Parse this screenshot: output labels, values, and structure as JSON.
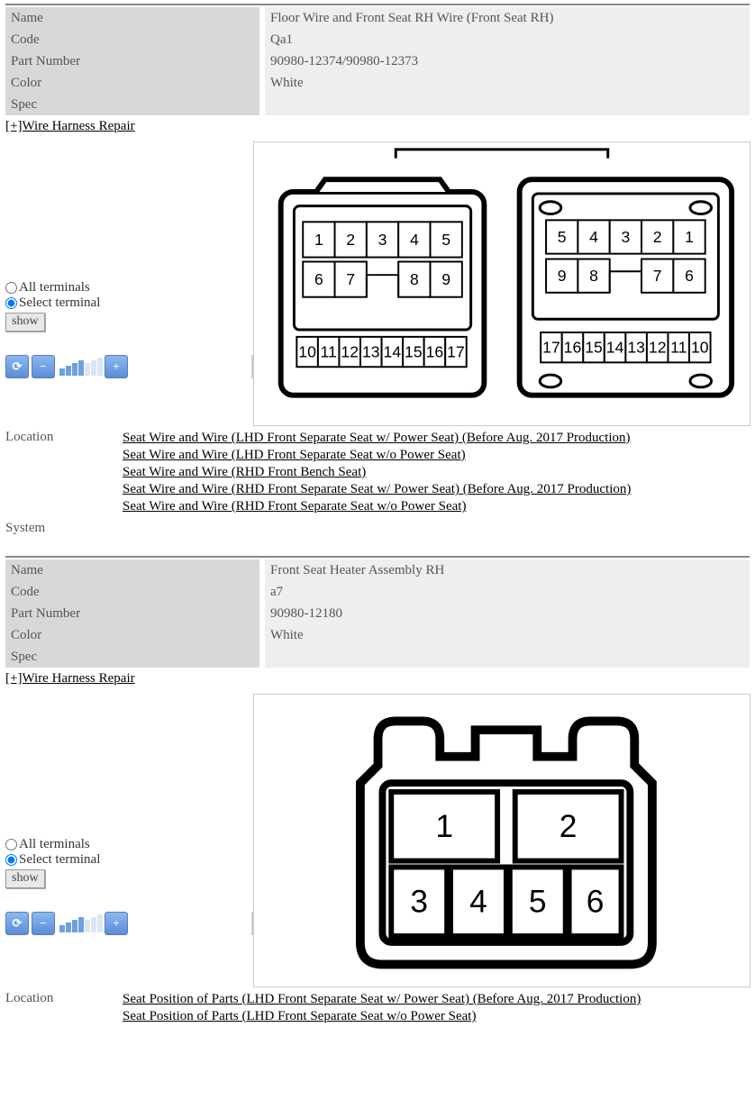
{
  "sections": [
    {
      "info": {
        "name_label": "Name",
        "name": "Floor Wire and Front Seat RH Wire (Front Seat RH)",
        "code_label": "Code",
        "code": "Qa1",
        "pn_label": "Part Number",
        "pn": "90980-12374/90980-12373",
        "color_label": "Color",
        "color": "White",
        "spec_label": "Spec",
        "spec": ""
      },
      "harness_link": "[+]Wire Harness Repair",
      "controls": {
        "all": "All terminals",
        "select": "Select terminal",
        "show": "show"
      },
      "connector_left_pins": {
        "row1": [
          1,
          2,
          3,
          4,
          5
        ],
        "row2": [
          6,
          7,
          8,
          9
        ],
        "row3": [
          10,
          11,
          12,
          13,
          14,
          15,
          16,
          17
        ]
      },
      "connector_right_pins": {
        "row1": [
          5,
          4,
          3,
          2,
          1
        ],
        "row2": [
          9,
          8,
          7,
          6
        ],
        "row3": [
          17,
          16,
          15,
          14,
          13,
          12,
          11,
          10
        ]
      },
      "location_label": "Location",
      "locations": [
        "Seat  Wire and Wire (LHD Front Separate Seat w/ Power Seat) (Before Aug. 2017 Production)",
        "Seat  Wire and Wire (LHD Front Separate Seat w/o Power Seat)",
        "Seat  Wire and Wire (RHD Front Bench Seat)",
        "Seat  Wire and Wire (RHD Front Separate Seat w/ Power Seat) (Before Aug. 2017 Production)",
        "Seat  Wire and Wire (RHD Front Separate Seat w/o Power Seat)"
      ],
      "system_label": "System"
    },
    {
      "info": {
        "name_label": "Name",
        "name": "Front Seat Heater Assembly RH",
        "code_label": "Code",
        "code": "a7",
        "pn_label": "Part Number",
        "pn": "90980-12180",
        "color_label": "Color",
        "color": "White",
        "spec_label": "Spec",
        "spec": ""
      },
      "harness_link": "[+]Wire Harness Repair",
      "controls": {
        "all": "All terminals",
        "select": "Select terminal",
        "show": "show"
      },
      "connector_pins": [
        1,
        2,
        3,
        4,
        5,
        6
      ],
      "location_label": "Location",
      "locations": [
        "Seat  Position of Parts (LHD Front Separate Seat w/ Power Seat) (Before Aug. 2017 Production)",
        "Seat  Position of Parts (LHD Front Separate Seat w/o Power Seat)"
      ]
    }
  ]
}
